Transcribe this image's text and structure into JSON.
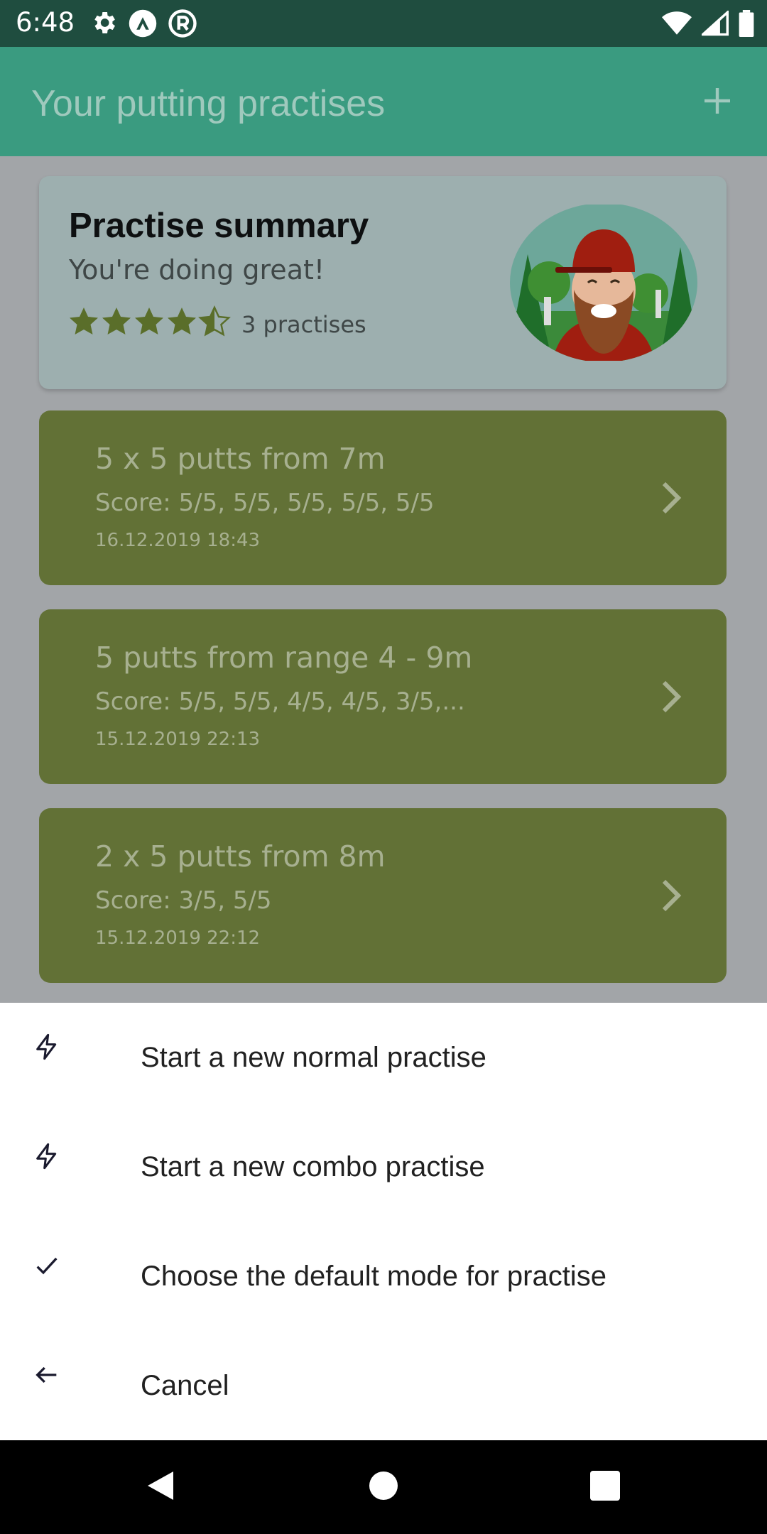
{
  "status_bar": {
    "time": "6:48",
    "left_icons": [
      "gear-icon",
      "app-a-icon",
      "app-r-icon"
    ],
    "right_icons": [
      "wifi-icon",
      "signal-icon",
      "battery-icon"
    ]
  },
  "app_bar": {
    "title": "Your putting practises",
    "action_icon": "plus-icon"
  },
  "summary": {
    "title": "Practise summary",
    "subtitle": "You're doing great!",
    "rating": 4.5,
    "rating_max": 5,
    "count_label": "3 practises"
  },
  "practises": [
    {
      "title": "5 x 5 putts from 7m",
      "score": "Score: 5/5, 5/5, 5/5, 5/5, 5/5",
      "date": "16.12.2019 18:43"
    },
    {
      "title": "5 putts from range 4 - 9m",
      "score": "Score: 5/5, 5/5, 4/5, 4/5, 3/5,...",
      "date": "15.12.2019 22:13"
    },
    {
      "title": "2 x 5 putts from 8m",
      "score": "Score: 3/5, 5/5",
      "date": "15.12.2019 22:12"
    }
  ],
  "bottom_sheet": {
    "items": [
      {
        "label": "Start a new normal practise",
        "icon": "lightning-icon"
      },
      {
        "label": "Start a new combo practise",
        "icon": "lightning-icon"
      },
      {
        "label": "Choose the default mode for practise",
        "icon": "checkmark-icon"
      },
      {
        "label": "Cancel",
        "icon": "arrow-left-icon"
      }
    ]
  },
  "nav_bar": {
    "buttons": [
      "back-icon",
      "home-icon",
      "recents-icon"
    ]
  },
  "colors": {
    "status_bar": "#1f4d3f",
    "app_bar": "#3a9b80",
    "scrim_background": "#a2a5a8",
    "summary_card": "#9dafaf",
    "practise_card": "#627136",
    "star": "#5a6e2a"
  }
}
